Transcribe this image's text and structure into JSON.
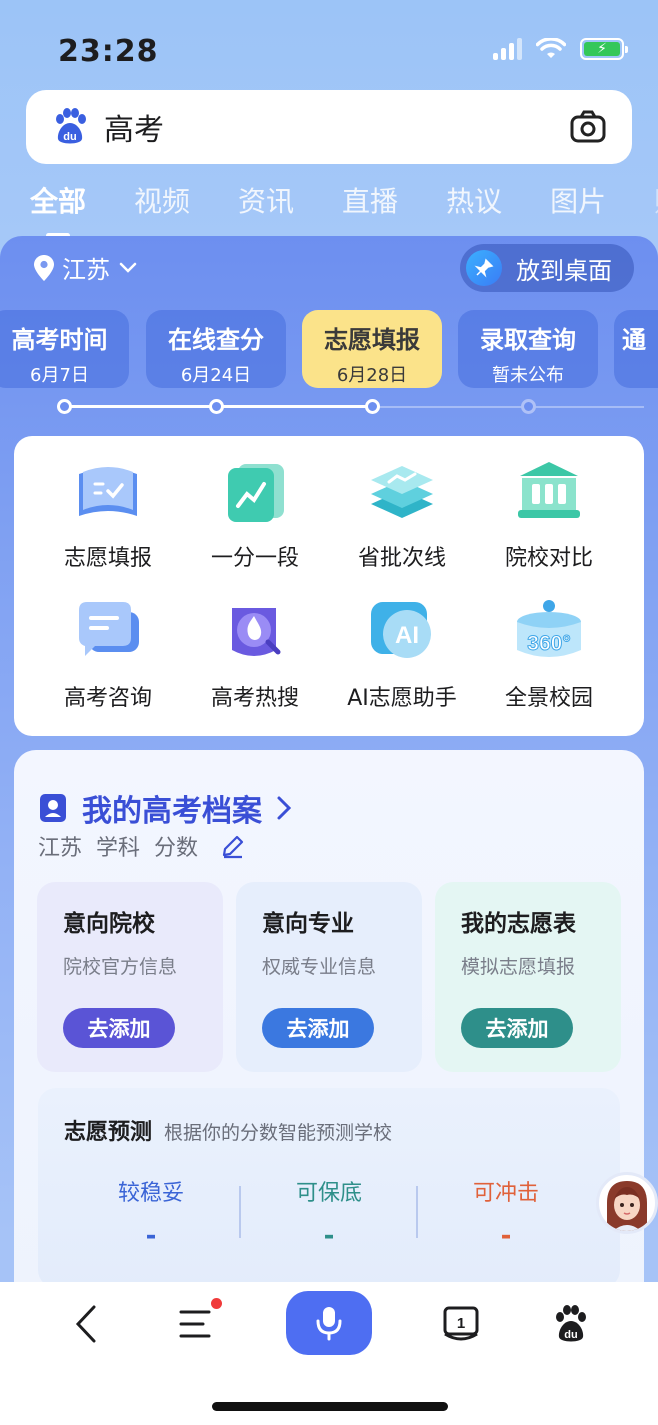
{
  "status": {
    "time": "23:28"
  },
  "search": {
    "query": "高考"
  },
  "tabs": [
    "全部",
    "视频",
    "资讯",
    "直播",
    "热议",
    "图片",
    "购"
  ],
  "location": {
    "province": "江苏",
    "pin_label": "放到桌面"
  },
  "timeline": [
    {
      "title": "高考时间",
      "date": "6月7日"
    },
    {
      "title": "在线查分",
      "date": "6月24日"
    },
    {
      "title": "志愿填报",
      "date": "6月28日",
      "active": true
    },
    {
      "title": "录取查询",
      "date": "暂未公布"
    },
    {
      "title": "通",
      "date": ""
    }
  ],
  "tools": [
    {
      "label": "志愿填报",
      "icon": "book-check-icon"
    },
    {
      "label": "一分一段",
      "icon": "chart-line-icon"
    },
    {
      "label": "省批次线",
      "icon": "layers-icon"
    },
    {
      "label": "院校对比",
      "icon": "building-icon"
    },
    {
      "label": "高考咨询",
      "icon": "chat-icon"
    },
    {
      "label": "高考热搜",
      "icon": "fire-search-icon"
    },
    {
      "label": "AI志愿助手",
      "icon": "ai-icon"
    },
    {
      "label": "全景校园",
      "icon": "panorama-360-icon"
    }
  ],
  "profile": {
    "title": "我的高考档案",
    "sub": [
      "江苏",
      "学科",
      "分数"
    ],
    "cards": [
      {
        "title": "意向院校",
        "desc": "院校官方信息",
        "button": "去添加",
        "color": "#5a54d6"
      },
      {
        "title": "意向专业",
        "desc": "权威专业信息",
        "button": "去添加",
        "color": "#3b78e0"
      },
      {
        "title": "我的志愿表",
        "desc": "模拟志愿填报",
        "button": "去添加",
        "color": "#2e8f8a"
      }
    ],
    "predict": {
      "title": "志愿预测",
      "hint": "根据你的分数智能预测学校",
      "cols": [
        {
          "label": "较稳妥",
          "value": "-",
          "color": "#3a64d6"
        },
        {
          "label": "可保底",
          "value": "-",
          "color": "#2e8f8a"
        },
        {
          "label": "可冲击",
          "value": "-",
          "color": "#e0613a"
        }
      ]
    }
  },
  "colors": {
    "accent": "#4e6ef2",
    "active_tab_card": "#fbe38a"
  }
}
